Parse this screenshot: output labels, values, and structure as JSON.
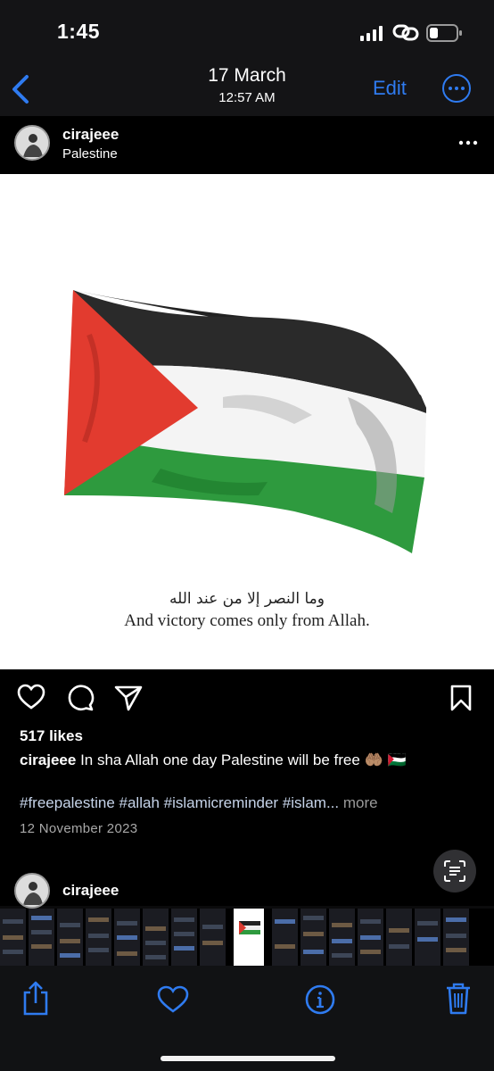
{
  "status_bar": {
    "time": "1:45"
  },
  "photos_header": {
    "date": "17 March",
    "time": "12:57 AM",
    "edit_label": "Edit"
  },
  "post": {
    "username": "cirajeee",
    "location": "Palestine",
    "image_arabic": "وما النصر إلا من عند الله",
    "image_caption": "And victory comes only from Allah.",
    "likes": "517 likes",
    "caption_user": "cirajeee",
    "caption_text": "In sha Allah one day Palestine will be free",
    "caption_emoji": "🤲🏽 🇵🇸",
    "hashtags": "#freepalestine #allah #islamicreminder #islam...",
    "more_label": "more",
    "date": "12 November 2023"
  },
  "next_post": {
    "username": "cirajeee"
  },
  "colors": {
    "accent": "#2f7bf0",
    "background": "#000000"
  }
}
